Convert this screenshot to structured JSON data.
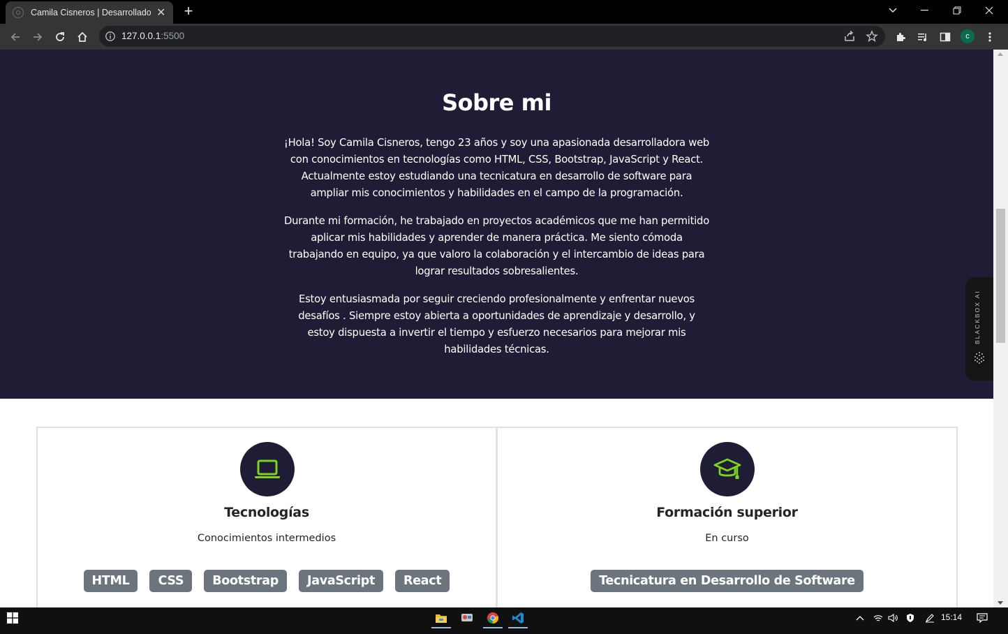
{
  "browser": {
    "tab_title": "Camila Cisneros | Desarrolladora",
    "url_host": "127.0.0.1",
    "url_port": ":5500",
    "profile_initial": "c"
  },
  "about": {
    "title": "Sobre mi",
    "paragraphs": [
      "¡Hola! Soy Camila Cisneros, tengo 23 años y soy una apasionada desarrolladora web con conocimientos en tecnologías como HTML, CSS, Bootstrap, JavaScript y React. Actualmente estoy estudiando una tecnicatura en desarrollo de software para ampliar mis conocimientos y habilidades en el campo de la programación.",
      "Durante mi formación, he trabajado en proyectos académicos que me han permitido aplicar mis habilidades y aprender de manera práctica. Me siento cómoda trabajando en equipo, ya que valoro la colaboración y el intercambio de ideas para lograr resultados sobresalientes.",
      "Estoy entusiasmada por seguir creciendo profesionalmente y enfrentar nuevos desafíos . Siempre estoy abierta a oportunidades de aprendizaje y desarrollo, y estoy dispuesta a invertir el tiempo y esfuerzo necesarios para mejorar mis habilidades técnicas."
    ]
  },
  "widget": {
    "label": "BLACKBOX AI"
  },
  "cards": [
    {
      "icon": "laptop-icon",
      "title": "Tecnologías",
      "subtitle": "Conocimientos intermedios",
      "badges": [
        "HTML",
        "CSS",
        "Bootstrap",
        "JavaScript",
        "React"
      ]
    },
    {
      "icon": "graduation-cap-icon",
      "title": "Formación superior",
      "subtitle": "En curso",
      "badges": [
        "Tecnicatura en Desarrollo de Software"
      ]
    }
  ],
  "taskbar": {
    "time": "15:14"
  },
  "colors": {
    "section_bg": "#1f1c35",
    "accent_green": "#7ed321",
    "badge_bg": "#6c757d"
  }
}
